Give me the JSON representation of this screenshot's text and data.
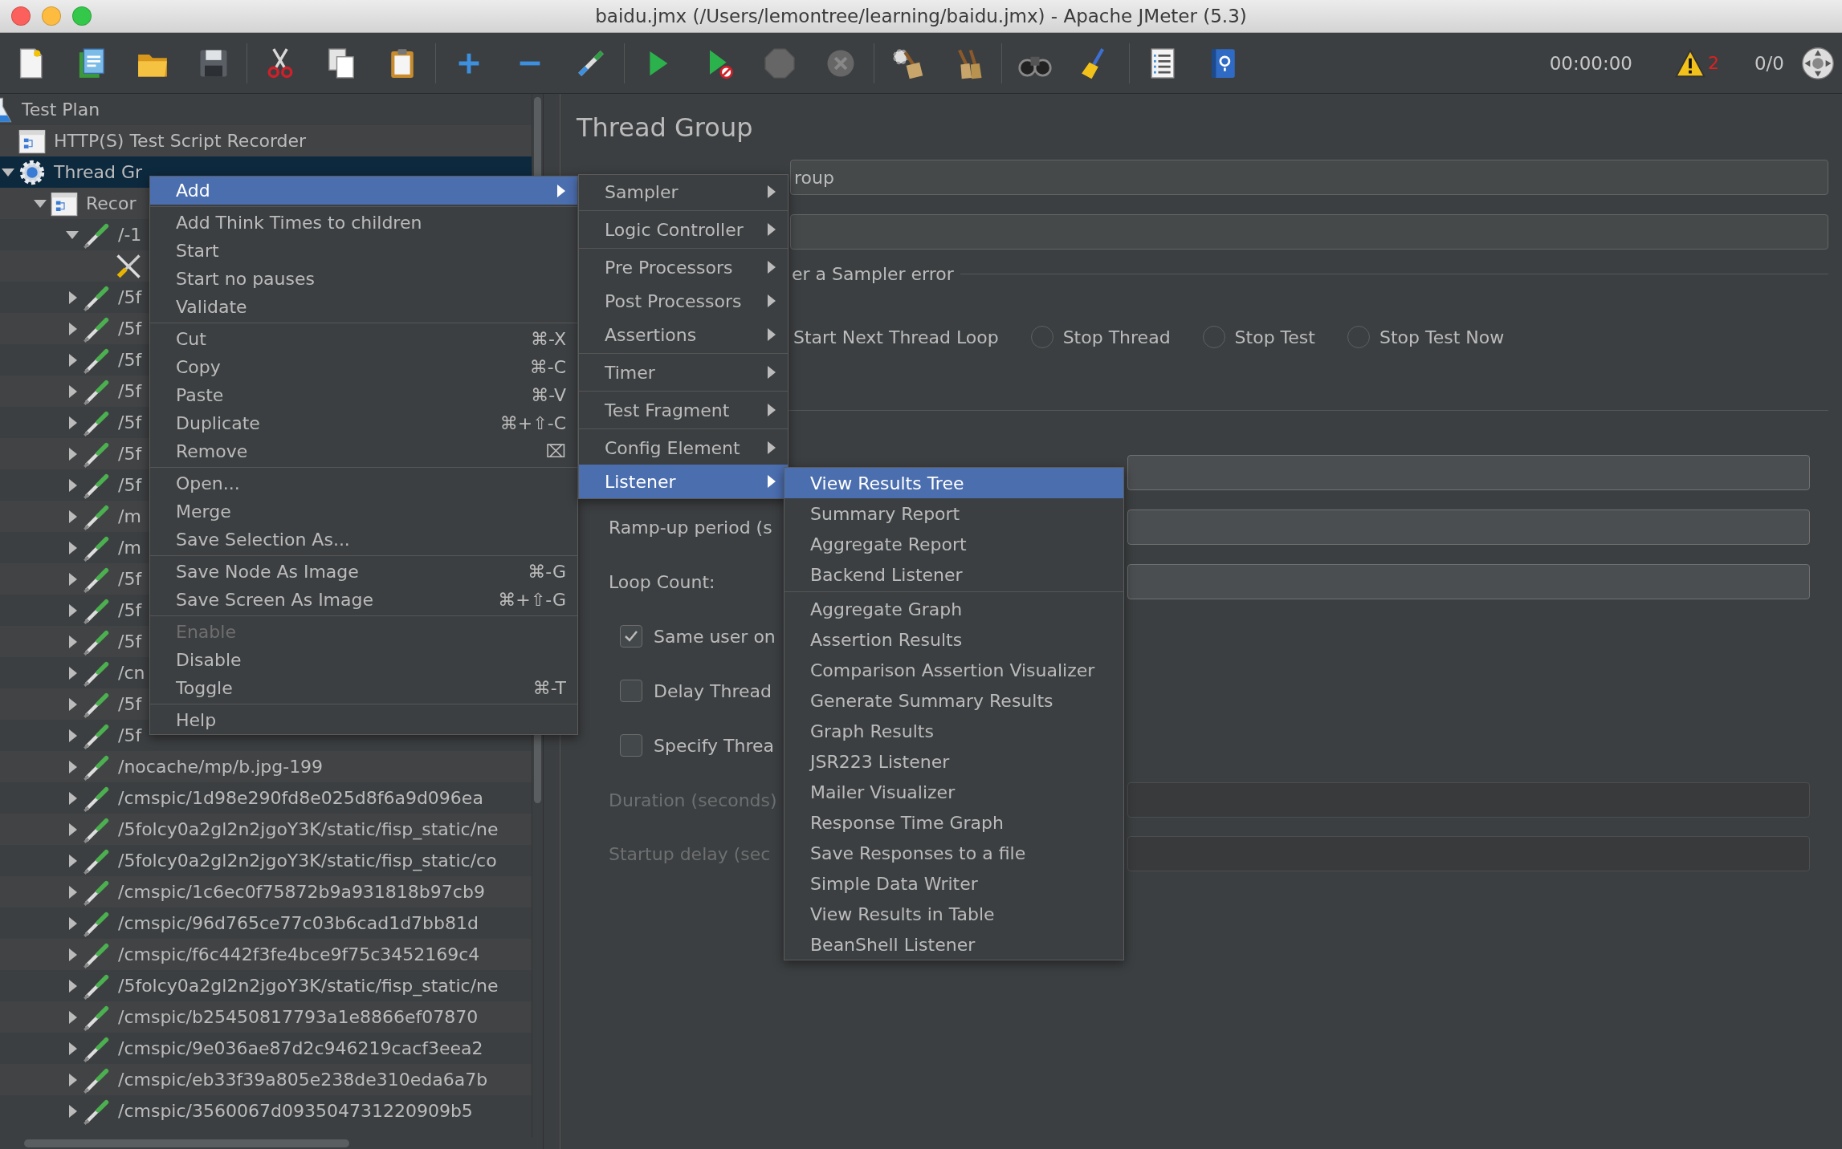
{
  "window": {
    "title": "baidu.jmx (/Users/lemontree/learning/baidu.jmx) - Apache JMeter (5.3)"
  },
  "toolbar": {
    "timer": "00:00:00",
    "warnings": "2",
    "threads": "0/0"
  },
  "tree": {
    "items": [
      {
        "label": "Test Plan",
        "kind": "plan",
        "selected": false,
        "children": [
          {
            "label": "HTTP(S) Test Script Recorder",
            "kind": "recorder",
            "selected": false
          },
          {
            "label": "Thread Gr",
            "kind": "thread-group",
            "selected": true,
            "expanded": true,
            "children": [
              {
                "label": "Recor",
                "kind": "controller",
                "selected": false,
                "expanded": true,
                "children": [
                  {
                    "label": "/-1",
                    "kind": "sampler",
                    "selected": false,
                    "expanded": true,
                    "children": [
                      {
                        "kind": "config",
                        "selected": false
                      }
                    ]
                  },
                  {
                    "label": "/5f",
                    "kind": "sampler",
                    "selected": false,
                    "expanded": false
                  },
                  {
                    "label": "/5f",
                    "kind": "sampler",
                    "selected": false,
                    "expanded": false
                  },
                  {
                    "label": "/5f",
                    "kind": "sampler",
                    "selected": false,
                    "expanded": false
                  },
                  {
                    "label": "/5f",
                    "kind": "sampler",
                    "selected": false,
                    "expanded": false
                  },
                  {
                    "label": "/5f",
                    "kind": "sampler",
                    "selected": false,
                    "expanded": false
                  },
                  {
                    "label": "/5f",
                    "kind": "sampler",
                    "selected": false,
                    "expanded": false
                  },
                  {
                    "label": "/5f",
                    "kind": "sampler",
                    "selected": false,
                    "expanded": false
                  },
                  {
                    "label": "/m",
                    "kind": "sampler",
                    "selected": false,
                    "expanded": false
                  },
                  {
                    "label": "/m",
                    "kind": "sampler",
                    "selected": false,
                    "expanded": false
                  },
                  {
                    "label": "/5f",
                    "kind": "sampler",
                    "selected": false,
                    "expanded": false
                  },
                  {
                    "label": "/5f",
                    "kind": "sampler",
                    "selected": false,
                    "expanded": false
                  },
                  {
                    "label": "/5f",
                    "kind": "sampler",
                    "selected": false,
                    "expanded": false
                  },
                  {
                    "label": "/cn",
                    "kind": "sampler",
                    "selected": false,
                    "expanded": false
                  },
                  {
                    "label": "/5f",
                    "kind": "sampler",
                    "selected": false,
                    "expanded": false
                  },
                  {
                    "label": "/5f",
                    "kind": "sampler",
                    "selected": false,
                    "expanded": false
                  },
                  {
                    "label": "/nocache/mp/b.jpg-199",
                    "kind": "sampler",
                    "selected": false,
                    "expanded": false
                  },
                  {
                    "label": "/cmspic/1d98e290fd8e025d8f6a9d096ea",
                    "kind": "sampler",
                    "selected": false,
                    "expanded": false
                  },
                  {
                    "label": "/5folcy0a2gl2n2jgoY3K/static/fisp_static/ne",
                    "kind": "sampler",
                    "selected": false,
                    "expanded": false
                  },
                  {
                    "label": "/5folcy0a2gl2n2jgoY3K/static/fisp_static/co",
                    "kind": "sampler",
                    "selected": false,
                    "expanded": false
                  },
                  {
                    "label": "/cmspic/1c6ec0f75872b9a931818b97cb9",
                    "kind": "sampler",
                    "selected": false,
                    "expanded": false
                  },
                  {
                    "label": "/cmspic/96d765ce77c03b6cad1d7bb81d",
                    "kind": "sampler",
                    "selected": false,
                    "expanded": false
                  },
                  {
                    "label": "/cmspic/f6c442f3fe4bce9f75c3452169c4",
                    "kind": "sampler",
                    "selected": false,
                    "expanded": false
                  },
                  {
                    "label": "/5folcy0a2gl2n2jgoY3K/static/fisp_static/ne",
                    "kind": "sampler",
                    "selected": false,
                    "expanded": false
                  },
                  {
                    "label": "/cmspic/b25450817793a1e8866ef07870",
                    "kind": "sampler",
                    "selected": false,
                    "expanded": false
                  },
                  {
                    "label": "/cmspic/9e036ae87d2c946219cacf3eea2",
                    "kind": "sampler",
                    "selected": false,
                    "expanded": false
                  },
                  {
                    "label": "/cmspic/eb33f39a805e238de310eda6a7b",
                    "kind": "sampler",
                    "selected": false,
                    "expanded": false
                  },
                  {
                    "label": "/cmspic/3560067d093504731220909b5",
                    "kind": "sampler",
                    "selected": false,
                    "expanded": false
                  }
                ]
              }
            ]
          }
        ]
      }
    ]
  },
  "form": {
    "title": "Thread Group",
    "name_field": {
      "value": "roup"
    },
    "error_action": {
      "legend": "er a Sampler error",
      "options": [
        {
          "label": "Start Next Thread Loop"
        },
        {
          "label": "Stop Thread",
          "selected": false
        },
        {
          "label": "Stop Test",
          "selected": false
        },
        {
          "label": "Stop Test Now",
          "selected": false
        }
      ]
    },
    "thread_properties": {
      "rows": [
        {
          "kind": "field",
          "disabled": false
        },
        {
          "kind": "field",
          "label": "Ramp-up period (s",
          "disabled": false
        },
        {
          "kind": "field",
          "label": "Loop Count:",
          "disabled": false
        },
        {
          "kind": "checkbox",
          "label": "Same user on",
          "checked": true
        },
        {
          "kind": "checkbox",
          "label": "Delay Thread",
          "checked": false
        },
        {
          "kind": "checkbox",
          "label": "Specify Threa",
          "checked": false
        },
        {
          "kind": "field",
          "label": "Duration (seconds)",
          "disabled": true
        },
        {
          "kind": "field",
          "label": "Startup delay (sec",
          "disabled": true
        }
      ]
    }
  },
  "context_menu": {
    "groups": [
      [
        {
          "label": "Add",
          "selected": true,
          "disabled": false,
          "submenu": true
        }
      ],
      [
        {
          "label": "Add Think Times to children",
          "selected": false,
          "disabled": false
        },
        {
          "label": "Start",
          "selected": false,
          "disabled": false
        },
        {
          "label": "Start no pauses",
          "selected": false,
          "disabled": false
        },
        {
          "label": "Validate",
          "selected": false,
          "disabled": false
        }
      ],
      [
        {
          "label": "Cut",
          "shortcut": "⌘-X",
          "selected": false,
          "disabled": false
        },
        {
          "label": "Copy",
          "shortcut": "⌘-C",
          "selected": false,
          "disabled": false
        },
        {
          "label": "Paste",
          "shortcut": "⌘-V",
          "selected": false,
          "disabled": false
        },
        {
          "label": "Duplicate",
          "shortcut": "⌘+⇧-C",
          "selected": false,
          "disabled": false
        },
        {
          "label": "Remove",
          "shortcut": "⌧",
          "selected": false,
          "disabled": false
        }
      ],
      [
        {
          "label": "Open...",
          "selected": false,
          "disabled": false
        },
        {
          "label": "Merge",
          "selected": false,
          "disabled": false
        },
        {
          "label": "Save Selection As...",
          "selected": false,
          "disabled": false
        }
      ],
      [
        {
          "label": "Save Node As Image",
          "shortcut": "⌘-G",
          "selected": false,
          "disabled": false
        },
        {
          "label": "Save Screen As Image",
          "shortcut": "⌘+⇧-G",
          "selected": false,
          "disabled": false
        }
      ],
      [
        {
          "label": "Enable",
          "selected": false,
          "disabled": true
        },
        {
          "label": "Disable",
          "selected": false,
          "disabled": false
        },
        {
          "label": "Toggle",
          "shortcut": "⌘-T",
          "selected": false,
          "disabled": false
        }
      ],
      [
        {
          "label": "Help",
          "selected": false,
          "disabled": false
        }
      ]
    ]
  },
  "add_submenu": {
    "groups": [
      [
        {
          "label": "Sampler",
          "selected": false,
          "submenu": true
        }
      ],
      [
        {
          "label": "Logic Controller",
          "selected": false,
          "submenu": true
        }
      ],
      [
        {
          "label": "Pre Processors",
          "selected": false,
          "submenu": true
        },
        {
          "label": "Post Processors",
          "selected": false,
          "submenu": true
        },
        {
          "label": "Assertions",
          "selected": false,
          "submenu": true
        }
      ],
      [
        {
          "label": "Timer",
          "selected": false,
          "submenu": true
        }
      ],
      [
        {
          "label": "Test Fragment",
          "selected": false,
          "submenu": true
        }
      ],
      [
        {
          "label": "Config Element",
          "selected": false,
          "submenu": true
        },
        {
          "label": "Listener",
          "selected": true,
          "submenu": true
        }
      ]
    ]
  },
  "listener_submenu": {
    "groups": [
      [
        {
          "label": "View Results Tree",
          "selected": true
        },
        {
          "label": "Summary Report",
          "selected": false
        },
        {
          "label": "Aggregate Report",
          "selected": false
        },
        {
          "label": "Backend Listener",
          "selected": false
        }
      ],
      [
        {
          "label": "Aggregate Graph",
          "selected": false
        },
        {
          "label": "Assertion Results",
          "selected": false
        },
        {
          "label": "Comparison Assertion Visualizer",
          "selected": false
        },
        {
          "label": "Generate Summary Results",
          "selected": false
        },
        {
          "label": "Graph Results",
          "selected": false
        },
        {
          "label": "JSR223 Listener",
          "selected": false
        },
        {
          "label": "Mailer Visualizer",
          "selected": false
        },
        {
          "label": "Response Time Graph",
          "selected": false
        },
        {
          "label": "Save Responses to a file",
          "selected": false
        },
        {
          "label": "Simple Data Writer",
          "selected": false
        },
        {
          "label": "View Results in Table",
          "selected": false
        },
        {
          "label": "BeanShell Listener",
          "selected": false
        }
      ]
    ]
  }
}
